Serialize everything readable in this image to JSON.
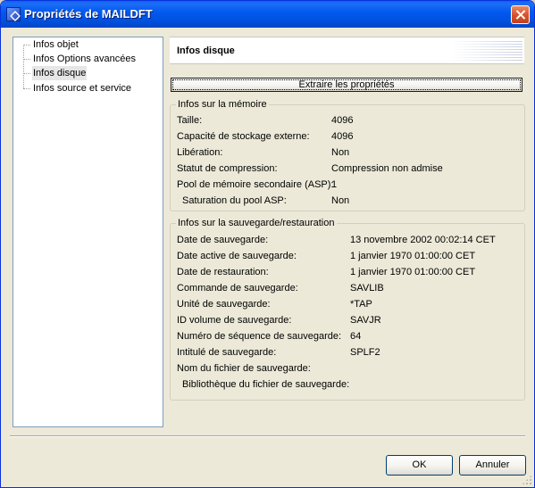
{
  "window": {
    "title": "Propriétés de MAILDFT"
  },
  "tree": {
    "items": [
      {
        "label": "Infos objet",
        "selected": false
      },
      {
        "label": "Infos Options avancées",
        "selected": false
      },
      {
        "label": "Infos disque",
        "selected": true
      },
      {
        "label": "Infos source et service",
        "selected": false
      }
    ]
  },
  "header": {
    "title": "Infos disque"
  },
  "extract_button": {
    "label": "Extraire les propriétés"
  },
  "memory_group": {
    "title": "Infos sur la mémoire",
    "rows": [
      {
        "label": "Taille:",
        "value": "4096"
      },
      {
        "label": "Capacité de stockage externe:",
        "value": "4096"
      },
      {
        "label": "Libération:",
        "value": "Non"
      },
      {
        "label": "Statut de compression:",
        "value": "Compression non admise"
      },
      {
        "label": "Pool de mémoire secondaire (ASP):",
        "value": "1"
      },
      {
        "label": "Saturation du pool ASP:",
        "value": "Non"
      }
    ]
  },
  "save_group": {
    "title": "Infos sur la sauvegarde/restauration",
    "rows": [
      {
        "label": "Date de sauvegarde:",
        "value": "13 novembre 2002 00:02:14 CET"
      },
      {
        "label": "Date active de sauvegarde:",
        "value": "1 janvier 1970 01:00:00 CET"
      },
      {
        "label": "Date de restauration:",
        "value": "1 janvier 1970 01:00:00 CET"
      },
      {
        "label": "Commande de sauvegarde:",
        "value": "SAVLIB"
      },
      {
        "label": "Unité de sauvegarde:",
        "value": "*TAP"
      },
      {
        "label": "ID volume de sauvegarde:",
        "value": "SAVJR"
      },
      {
        "label": "Numéro de séquence de sauvegarde:",
        "value": "64"
      },
      {
        "label": "Intitulé de sauvegarde:",
        "value": "SPLF2"
      },
      {
        "label": "Nom du fichier de sauvegarde:",
        "value": ""
      },
      {
        "label": "Bibliothèque du fichier de sauvegarde:",
        "value": ""
      }
    ]
  },
  "footer": {
    "ok_label": "OK",
    "cancel_label": "Annuler"
  }
}
